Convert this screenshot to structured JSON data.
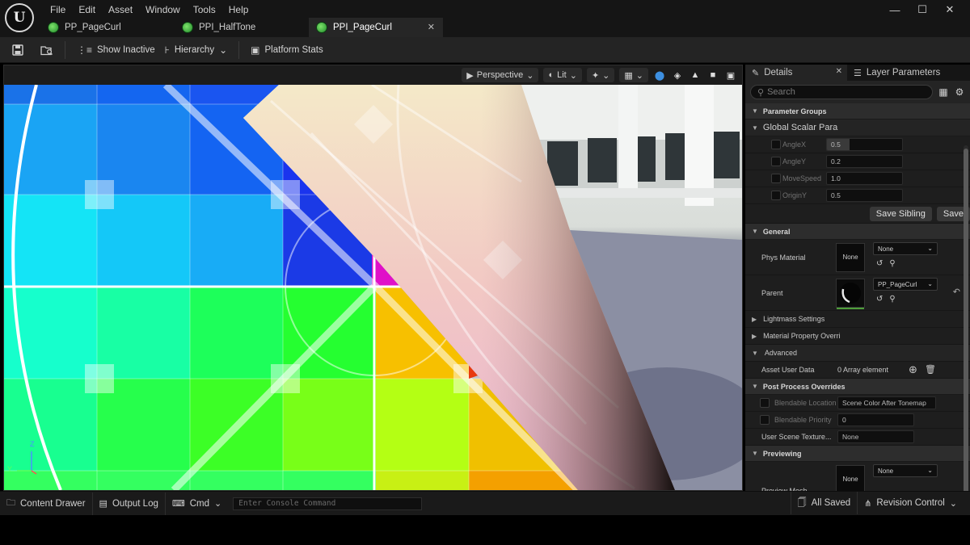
{
  "menu": [
    "File",
    "Edit",
    "Asset",
    "Window",
    "Tools",
    "Help"
  ],
  "logo_icon": "unreal-engine-logo-icon",
  "window_controls": [
    "minimize-icon",
    "maximize-icon",
    "close-icon"
  ],
  "tabs": [
    {
      "label": "PP_PageCurl",
      "active": false
    },
    {
      "label": "PPI_HalfTone",
      "active": false
    },
    {
      "label": "PPI_PageCurl",
      "active": true
    }
  ],
  "toolbar": {
    "show_inactive": "Show Inactive",
    "hierarchy": "Hierarchy",
    "platform_stats": "Platform Stats"
  },
  "viewport": {
    "perspective": "Perspective",
    "lit": "Lit",
    "axis_z": "Z",
    "axis_y": "Y"
  },
  "panel": {
    "details_tab": "Details",
    "layer_tab": "Layer Parameters",
    "search_placeholder": "Search"
  },
  "sections": {
    "parameter_groups": "Parameter Groups",
    "global_scalar": "Global Scalar Para",
    "general": "General",
    "lightmass": "Lightmass Settings",
    "material_property": "Material Property Overri",
    "advanced": "Advanced",
    "post_process": "Post Process Overrides",
    "previewing": "Previewing"
  },
  "scalar_params": [
    {
      "name": "AngleX",
      "value": "0.5",
      "fill": 0.3
    },
    {
      "name": "AngleY",
      "value": "0.2",
      "fill": 0.0
    },
    {
      "name": "MoveSpeed",
      "value": "1.0",
      "fill": 0.0
    },
    {
      "name": "OriginY",
      "value": "0.5",
      "fill": 0.0
    }
  ],
  "buttons": {
    "save_sibling": "Save Sibling",
    "save": "Save"
  },
  "general": {
    "phys_material_label": "Phys Material",
    "phys_material_thumb": "None",
    "phys_material_value": "None",
    "parent_label": "Parent",
    "parent_value": "PP_PageCurl"
  },
  "advanced": {
    "asset_user_data_label": "Asset User Data",
    "asset_user_data_value": "0 Array element"
  },
  "post_process": {
    "blendable_location_label": "Blendable Location",
    "blendable_location_value": "Scene Color After Tonemap",
    "blendable_priority_label": "Blendable Priority",
    "blendable_priority_value": "0",
    "user_scene_texture_label": "User Scene Texture...",
    "user_scene_texture_value": "None"
  },
  "previewing": {
    "preview_mesh_label": "Preview Mesh",
    "preview_mesh_thumb": "None",
    "preview_mesh_value": "None"
  },
  "status": {
    "content_drawer": "Content Drawer",
    "output_log": "Output Log",
    "cmd": "Cmd",
    "console_placeholder": "Enter Console Command",
    "all_saved": "All Saved",
    "revision_control": "Revision Control"
  },
  "colors": {
    "accent_green": "#4e9e3a",
    "background": "#1b1b1b",
    "viewport_blue": "#1476e6",
    "viewport_green": "#1dff3c",
    "viewport_orange": "#f5b400"
  }
}
